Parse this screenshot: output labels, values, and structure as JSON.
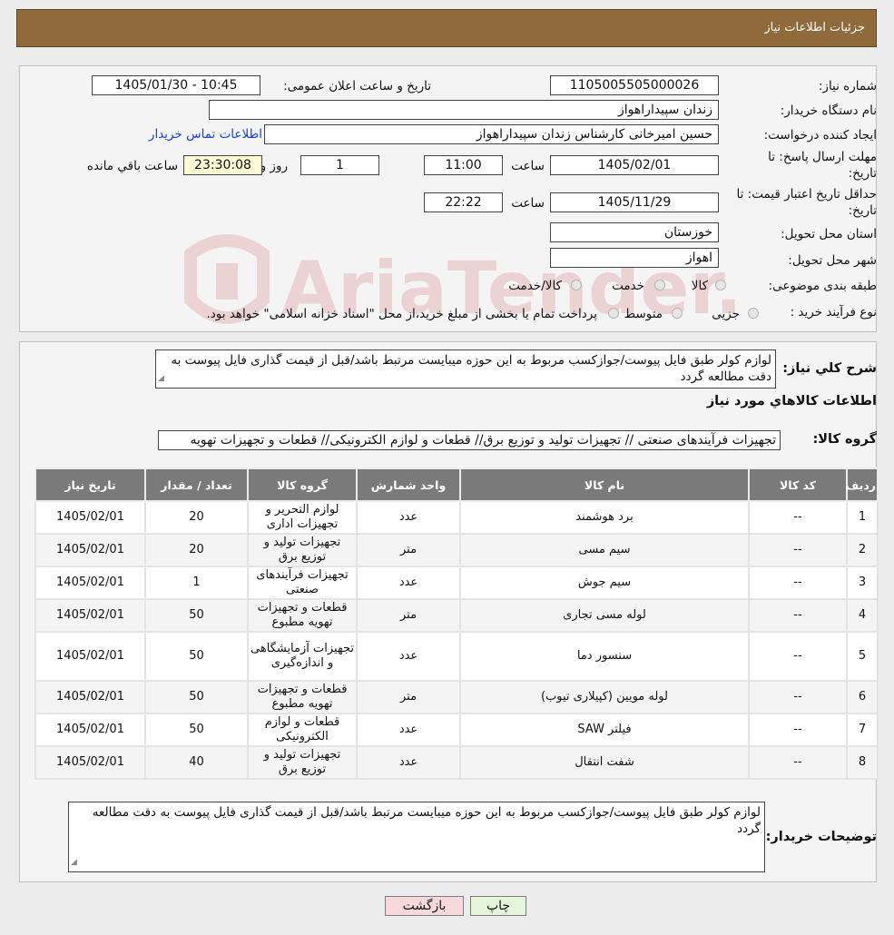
{
  "header": {
    "title": "جزئیات اطلاعات نیاز"
  },
  "form": {
    "need_number_label": "شماره نیاز:",
    "need_number": "1105005505000026",
    "announce_label": "تاریخ و ساعت اعلان عمومی:",
    "announce_value": "1405/01/30 - 10:45",
    "buyer_org_label": "نام دستگاه خریدار:",
    "buyer_org": "زندان سپیداراهواز",
    "requester_label": "ایجاد کننده درخواست:",
    "requester": "حسین امیرخانی کارشناس زندان سپیداراهواز",
    "contact_link": "اطلاعات تماس خریدار",
    "deadline_label_1": "مهلت ارسال پاسخ: تا",
    "deadline_label_2": "تاریخ:",
    "deadline_date": "1405/02/01",
    "time_label": "ساعت",
    "deadline_time": "11:00",
    "days_value": "1",
    "days_label": "روز و",
    "remaining_value": "23:30:08",
    "remaining_label": "ساعت باقي مانده",
    "validity_label_1": "حداقل تاریخ اعتبار قیمت: تا",
    "validity_label_2": "تاریخ:",
    "validity_date": "1405/11/29",
    "validity_time": "22:22",
    "province_label": "استان محل تحویل:",
    "province": "خوزستان",
    "city_label": "شهر محل تحویل:",
    "city": "اهواز",
    "category_label": "طبقه بندی موضوعی:",
    "category_options": [
      "کالا",
      "خدمت",
      "کالا/خدمت"
    ],
    "process_label": "نوع فرآیند خرید :",
    "process_options": [
      "جزیی",
      "متوسط"
    ],
    "process_note": "پرداخت تمام یا بخشی از مبلغ خرید،از محل \"اسناد خزانه اسلامی\" خواهد بود."
  },
  "description": {
    "label": "شرح کلي نیاز:",
    "text": "لوازم کولر طبق فایل پیوست/جوازکسب مربوط به این حوزه میبایست مرتبط باشد/قبل از قیمت گذاری فایل پیوست به دقت مطالعه گردد"
  },
  "goods": {
    "section_title": "اطلاعات کالاهاي مورد نياز",
    "group_label": "گروه کالا:",
    "group_value": "تجهیزات فرآیندهای صنعتی // تجهیزات تولید و توزیع برق// قطعات و لوازم الکترونیکی//  قطعات و تجهیزات تهویه",
    "columns": [
      "رديف",
      "کد کالا",
      "نام کالا",
      "واحد شمارش",
      "گروه کالا",
      "تعداد / مقدار",
      "تاریخ نیاز"
    ],
    "rows": [
      [
        "1",
        "--",
        "برد هوشمند",
        "عدد",
        "لوازم التحریر و تجهیزات اداری",
        "20",
        "1405/02/01"
      ],
      [
        "2",
        "--",
        "سیم مسی",
        "متر",
        "تجهیزات تولید و توزیع برق",
        "20",
        "1405/02/01"
      ],
      [
        "3",
        "--",
        "سیم جوش",
        "عدد",
        "تجهیزات فرآیندهای صنعتی",
        "1",
        "1405/02/01"
      ],
      [
        "4",
        "--",
        "لوله مسی تجاری",
        "متر",
        "قطعات و تجهیزات تهویه مطبوع",
        "50",
        "1405/02/01"
      ],
      [
        "5",
        "--",
        "سنسور دما",
        "عدد",
        "تجهیزات آزمایشگاهی و اندازه‌گیری",
        "50",
        "1405/02/01"
      ],
      [
        "6",
        "--",
        "لوله مویین (کپیلاری تیوب)",
        "متر",
        "قطعات و تجهیزات تهویه مطبوع",
        "50",
        "1405/02/01"
      ],
      [
        "7",
        "--",
        "فیلتر SAW",
        "عدد",
        "قطعات و لوازم الکترونیکی",
        "50",
        "1405/02/01"
      ],
      [
        "8",
        "--",
        "شفت انتقال",
        "عدد",
        "تجهیزات تولید و توزیع برق",
        "40",
        "1405/02/01"
      ]
    ]
  },
  "buyer_notes": {
    "label": "توضیحات خریدار:",
    "text": "لوازم کولر طبق فایل پیوست/جوازکسب مربوط به این حوزه میبایست مرتبط باشد/قبل از قیمت گذاری فایل پیوست به دقت مطالعه گردد"
  },
  "buttons": {
    "print": "چاپ",
    "back": "بازگشت"
  },
  "watermark": {
    "text": "AriaTender.neT"
  },
  "colors": {
    "header": "#8f6b3c",
    "table_header": "#7a7a7a",
    "link": "#1a43c8",
    "back_button": "#f7d9dc",
    "print_button": "#e4f5dc"
  }
}
